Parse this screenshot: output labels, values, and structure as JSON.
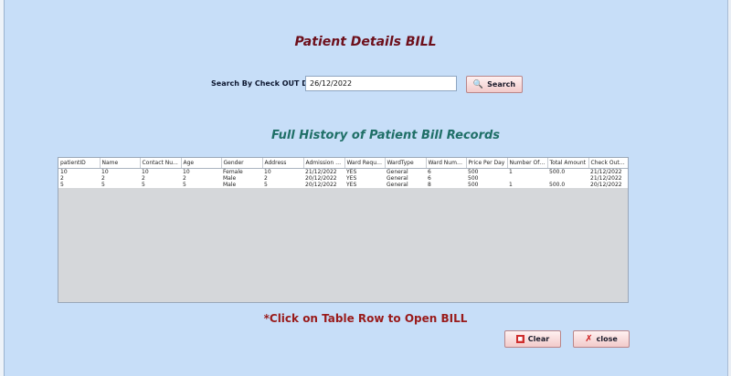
{
  "header": {
    "title": "Patient Details BILL"
  },
  "search": {
    "label": "Search By Check OUT Date",
    "value": "26/12/2022",
    "button_label": "Search"
  },
  "history": {
    "title": "Full History of Patient Bill Records"
  },
  "table": {
    "columns": [
      "patientID",
      "Name",
      "Contact Nu...",
      "Age",
      "Gender",
      "Address",
      "Admission D...",
      "Ward Reque...",
      "WardType",
      "Ward Number",
      "Price Per Day",
      "Number Of ...",
      "Total Amount",
      "Check Out ..."
    ],
    "rows": [
      [
        "10",
        "10",
        "10",
        "10",
        "Female",
        "10",
        "21/12/2022",
        "YES",
        "General",
        "6",
        "500",
        "1",
        "500.0",
        "21/12/2022"
      ],
      [
        "2",
        "2",
        "2",
        "2",
        "Male",
        "2",
        "20/12/2022",
        "YES",
        "General",
        "6",
        "500",
        "",
        "",
        "21/12/2022"
      ],
      [
        "5",
        "5",
        "5",
        "5",
        "Male",
        "5",
        "20/12/2022",
        "YES",
        "General",
        "8",
        "500",
        "1",
        "500.0",
        "20/12/2022"
      ]
    ]
  },
  "footer": {
    "hint": "*Click on Table Row to Open BILL",
    "clear_label": "Clear",
    "close_label": "close"
  },
  "colors": {
    "background": "#c7def8",
    "title": "#6d0f1b",
    "subtitle": "#1f6f67",
    "hint": "#991b1b"
  }
}
